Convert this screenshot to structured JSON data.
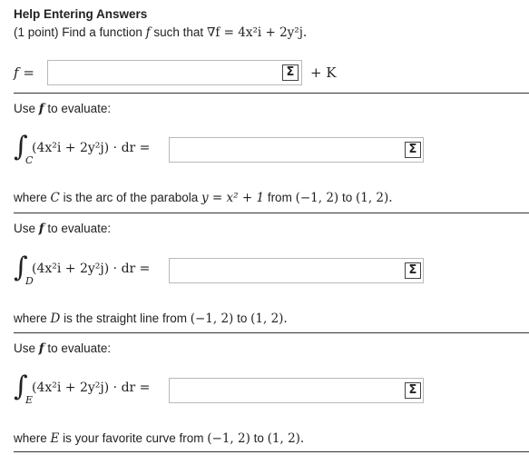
{
  "header": {
    "title": "Help Entering Answers",
    "prompt_prefix": "(1 point) Find a function",
    "prompt_f": "f",
    "prompt_mid": "such that",
    "prompt_math": "∇f = 4x²i + 2y²j."
  },
  "answer_f": {
    "label": "f =",
    "value": "",
    "suffix": "+ K",
    "sigma": "Σ"
  },
  "sections": [
    {
      "use_text_prefix": "Use",
      "use_f": "f",
      "use_text_suffix": "to evaluate:",
      "integral_sub": "C",
      "integrand": "(4x²i + 2y²j) · dr =",
      "input_value": "",
      "sigma": "Σ",
      "where_prefix": "where",
      "where_var": "C",
      "where_text": "is the arc of the parabola",
      "where_math": "y = x² + 1",
      "where_from": "from",
      "from_pt": "(−1, 2)",
      "to_word": "to",
      "to_pt": "(1, 2)."
    },
    {
      "use_text_prefix": "Use",
      "use_f": "f",
      "use_text_suffix": "to evaluate:",
      "integral_sub": "D",
      "integrand": "(4x²i + 2y²j) · dr =",
      "input_value": "",
      "sigma": "Σ",
      "where_prefix": "where",
      "where_var": "D",
      "where_text": "is the straight line from",
      "where_math": "",
      "where_from": "",
      "from_pt": "(−1, 2)",
      "to_word": "to",
      "to_pt": "(1, 2)."
    },
    {
      "use_text_prefix": "Use",
      "use_f": "f",
      "use_text_suffix": "to evaluate:",
      "integral_sub": "E",
      "integrand": "(4x²i + 2y²j) · dr =",
      "input_value": "",
      "sigma": "Σ",
      "where_prefix": "where",
      "where_var": "E",
      "where_text": "is your favorite curve from",
      "where_math": "",
      "where_from": "",
      "from_pt": "(−1, 2)",
      "to_word": "to",
      "to_pt": "(1, 2)."
    }
  ]
}
